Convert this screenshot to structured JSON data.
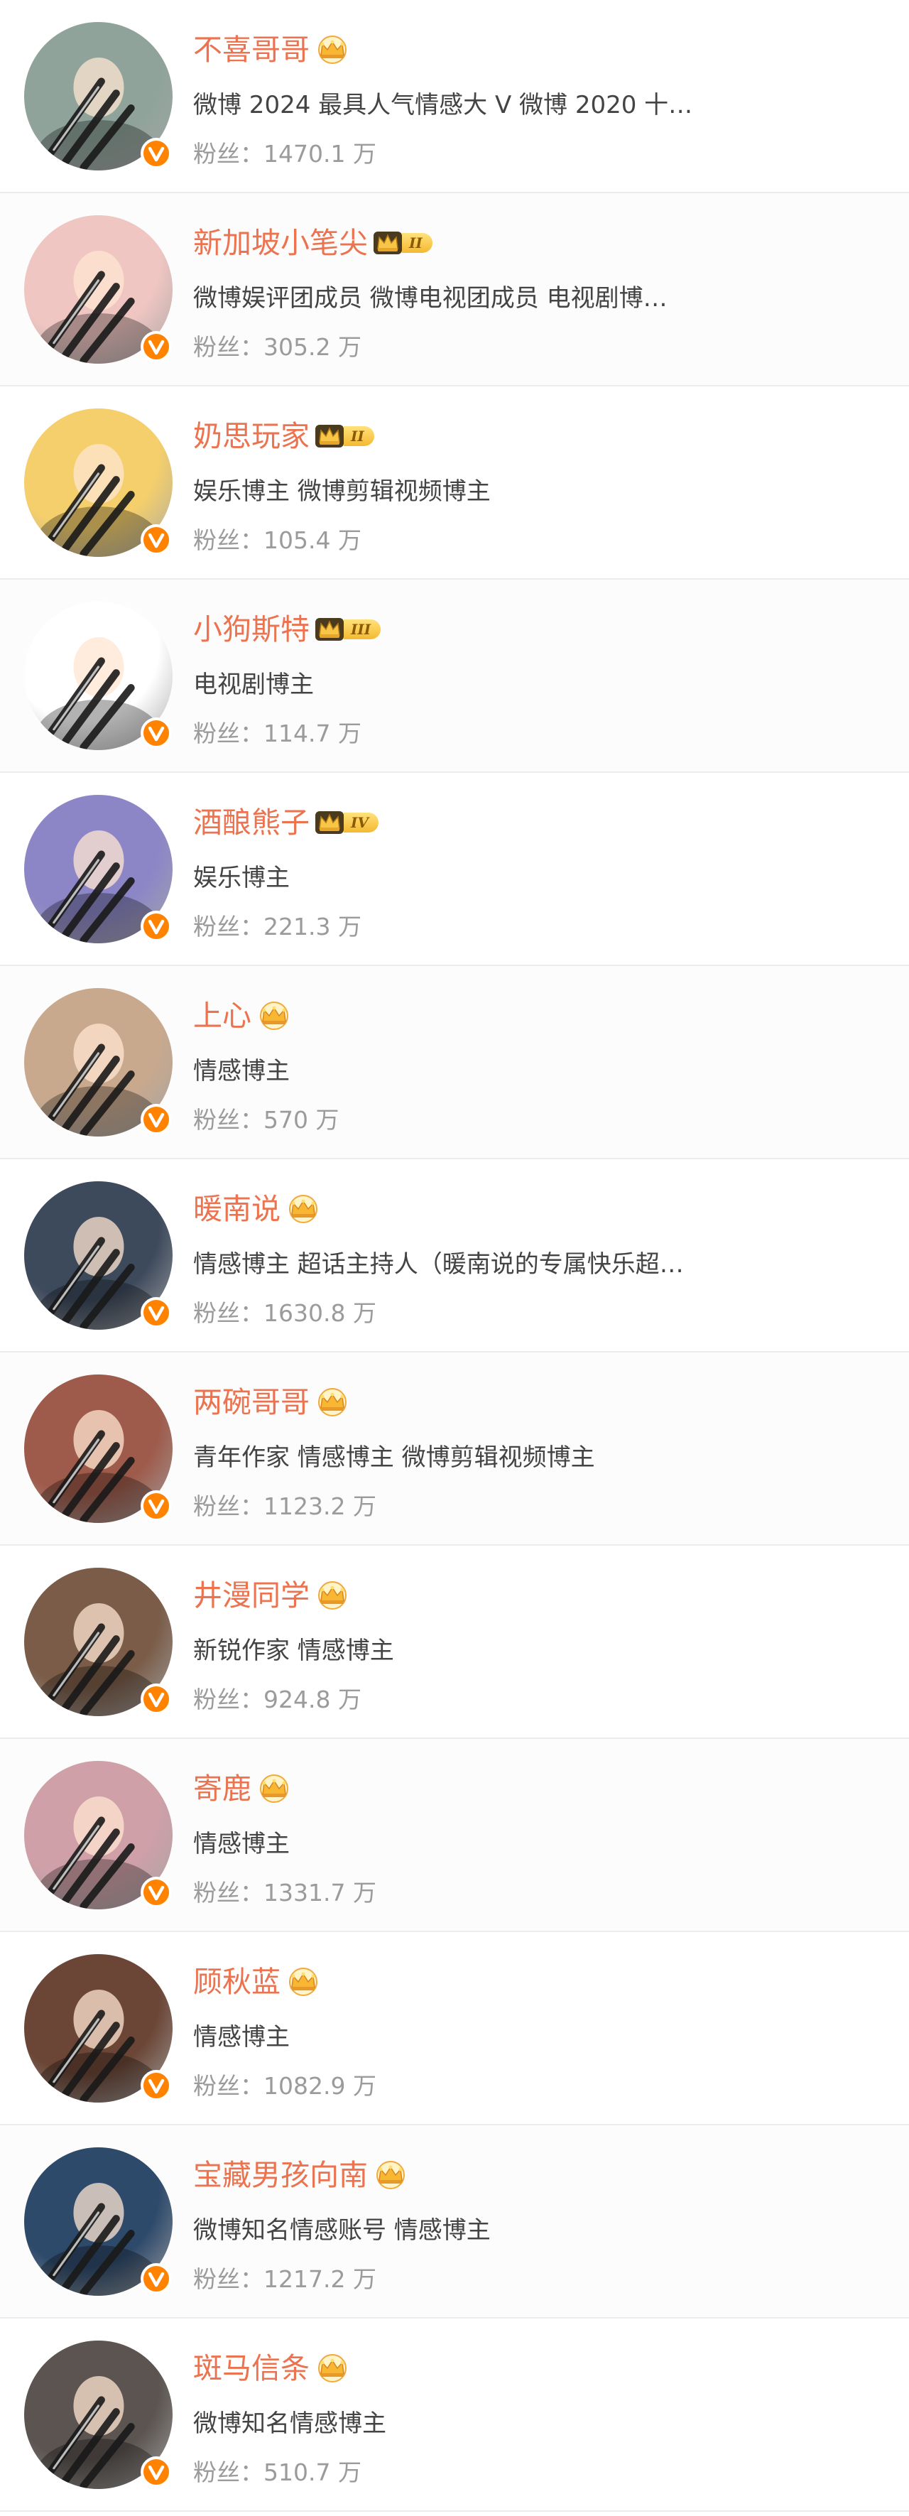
{
  "fans_label": "粉丝：",
  "users": [
    {
      "name": "不喜哥哥",
      "crown_level": "",
      "description": "微博 2024 最具人气情感大 V 微博 2020 十…",
      "fans": "1470.1 万",
      "avatar_color": "#8fa39a",
      "avatar_icon": "person-photo-avatar"
    },
    {
      "name": "新加坡小笔尖",
      "crown_level": "II",
      "description": "微博娱评团成员 微博电视团成员 电视剧博…",
      "fans": "305.2 万",
      "avatar_color": "#f0c6c2",
      "avatar_icon": "cartoon-girl-avatar"
    },
    {
      "name": "奶思玩家",
      "crown_level": "II",
      "description": "娱乐博主 微博剪辑视频博主",
      "fans": "105.4 万",
      "avatar_color": "#f4cf6b",
      "avatar_icon": "pompompurin-avatar"
    },
    {
      "name": "小狗斯特",
      "crown_level": "III",
      "description": "电视剧博主",
      "fans": "114.7 万",
      "avatar_color": "#ffffff",
      "avatar_icon": "monster-mouth-avatar"
    },
    {
      "name": "酒酿熊子",
      "crown_level": "IV",
      "description": "娱乐博主",
      "fans": "221.3 万",
      "avatar_color": "#8c86c7",
      "avatar_icon": "anime-girl-avatar"
    },
    {
      "name": "上心",
      "crown_level": "",
      "description": "情感博主",
      "fans": "570 万",
      "avatar_color": "#c9a98d",
      "avatar_icon": "person-photo-avatar"
    },
    {
      "name": "暖南说",
      "crown_level": "",
      "description": "情感博主 超话主持人（暖南说的专属快乐超…",
      "fans": "1630.8 万",
      "avatar_color": "#3d4a5c",
      "avatar_icon": "person-photo-avatar"
    },
    {
      "name": "两碗哥哥",
      "crown_level": "",
      "description": "青年作家 情感博主 微博剪辑视频博主",
      "fans": "1123.2 万",
      "avatar_color": "#9e5a4a",
      "avatar_icon": "person-photo-avatar"
    },
    {
      "name": "井漫同学",
      "crown_level": "",
      "description": "新锐作家 情感博主",
      "fans": "924.8 万",
      "avatar_color": "#7a5c48",
      "avatar_icon": "person-photo-avatar"
    },
    {
      "name": "寄鹿",
      "crown_level": "",
      "description": "情感博主",
      "fans": "1331.7 万",
      "avatar_color": "#cfa0a8",
      "avatar_icon": "person-photo-avatar"
    },
    {
      "name": "顾秋蓝",
      "crown_level": "",
      "description": "情感博主",
      "fans": "1082.9 万",
      "avatar_color": "#6b4636",
      "avatar_icon": "person-photo-avatar"
    },
    {
      "name": "宝藏男孩向南",
      "crown_level": "",
      "description": "微博知名情感账号 情感博主",
      "fans": "1217.2 万",
      "avatar_color": "#2e4a6b",
      "avatar_icon": "person-photo-avatar"
    },
    {
      "name": "斑马信条",
      "crown_level": "",
      "description": "微博知名情感博主",
      "fans": "510.7 万",
      "avatar_color": "#5b5450",
      "avatar_icon": "person-photo-avatar"
    }
  ]
}
